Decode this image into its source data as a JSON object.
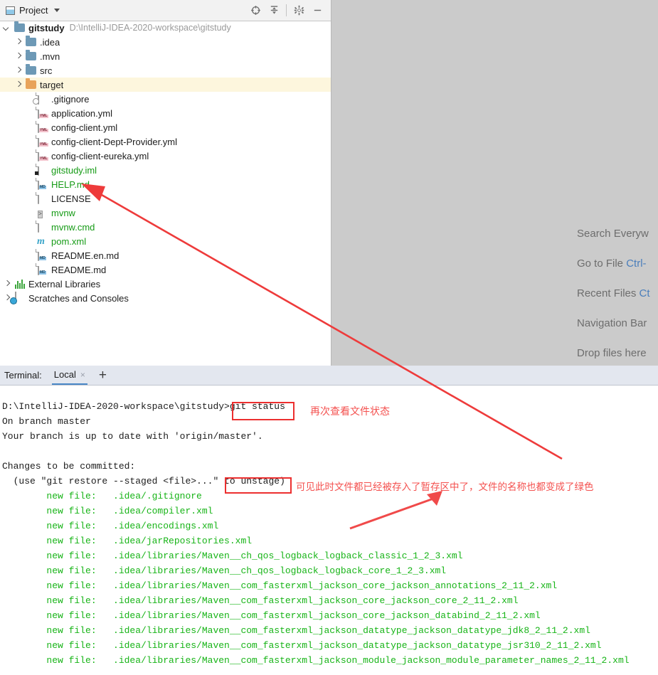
{
  "project_panel": {
    "title": "Project",
    "icons": [
      "locate-icon",
      "collapse-all-icon",
      "settings-gear-icon",
      "hide-icon"
    ],
    "root": {
      "name": "gitstudy",
      "path": "D:\\IntelliJ-IDEA-2020-workspace\\gitstudy"
    },
    "items": [
      {
        "label": ".idea",
        "icon": "folder-icon",
        "expandable": true,
        "indent": 1,
        "color": "default",
        "selected": false
      },
      {
        "label": ".mvn",
        "icon": "folder-icon",
        "expandable": true,
        "indent": 1,
        "color": "default",
        "selected": false
      },
      {
        "label": "src",
        "icon": "folder-icon",
        "expandable": true,
        "indent": 1,
        "color": "default",
        "selected": false
      },
      {
        "label": "target",
        "icon": "folder-orange-icon",
        "expandable": true,
        "indent": 1,
        "color": "default",
        "selected": true
      },
      {
        "label": ".gitignore",
        "icon": "gitignore-file-icon",
        "expandable": false,
        "indent": 2,
        "color": "default",
        "selected": false
      },
      {
        "label": "application.yml",
        "icon": "yml-file-icon",
        "expandable": false,
        "indent": 2,
        "color": "default",
        "selected": false
      },
      {
        "label": "config-client.yml",
        "icon": "yml-file-icon",
        "expandable": false,
        "indent": 2,
        "color": "default",
        "selected": false
      },
      {
        "label": "config-client-Dept-Provider.yml",
        "icon": "yml-file-icon",
        "expandable": false,
        "indent": 2,
        "color": "default",
        "selected": false
      },
      {
        "label": "config-client-eureka.yml",
        "icon": "yml-file-icon",
        "expandable": false,
        "indent": 2,
        "color": "default",
        "selected": false
      },
      {
        "label": "gitstudy.iml",
        "icon": "iml-file-icon",
        "expandable": false,
        "indent": 2,
        "color": "green",
        "selected": false
      },
      {
        "label": "HELP.md",
        "icon": "md-file-icon",
        "expandable": false,
        "indent": 2,
        "color": "green",
        "selected": false
      },
      {
        "label": "LICENSE",
        "icon": "text-file-icon",
        "expandable": false,
        "indent": 2,
        "color": "default",
        "selected": false
      },
      {
        "label": "mvnw",
        "icon": "script-file-icon",
        "expandable": false,
        "indent": 2,
        "color": "green",
        "selected": false
      },
      {
        "label": "mvnw.cmd",
        "icon": "text-file-icon",
        "expandable": false,
        "indent": 2,
        "color": "green",
        "selected": false
      },
      {
        "label": "pom.xml",
        "icon": "maven-file-icon",
        "expandable": false,
        "indent": 2,
        "color": "green",
        "selected": false
      },
      {
        "label": "README.en.md",
        "icon": "md-file-icon",
        "expandable": false,
        "indent": 2,
        "color": "default",
        "selected": false
      },
      {
        "label": "README.md",
        "icon": "md-file-icon",
        "expandable": false,
        "indent": 2,
        "color": "default",
        "selected": false
      },
      {
        "label": "External Libraries",
        "icon": "libraries-icon",
        "expandable": true,
        "indent": 0,
        "color": "default",
        "selected": false
      },
      {
        "label": "Scratches and Consoles",
        "icon": "scratches-icon",
        "expandable": true,
        "indent": 0,
        "color": "default",
        "selected": false
      }
    ]
  },
  "editor": {
    "hints": [
      {
        "action": "Search Everyw",
        "key": ""
      },
      {
        "action": "Go to File ",
        "key": "Ctrl-"
      },
      {
        "action": "Recent Files ",
        "key": "Ct"
      },
      {
        "action": "Navigation Bar",
        "key": ""
      },
      {
        "action": "Drop files here",
        "key": ""
      }
    ]
  },
  "terminal": {
    "label": "Terminal:",
    "tabs": [
      {
        "name": "Local",
        "active": true,
        "close": "×"
      }
    ],
    "add_tab": "+",
    "lines": [
      {
        "text": "D:\\IntelliJ-IDEA-2020-workspace\\gitstudy>git status",
        "color": "default"
      },
      {
        "text": "On branch master",
        "color": "default"
      },
      {
        "text": "Your branch is up to date with 'origin/master'.",
        "color": "default"
      },
      {
        "text": "",
        "color": "default"
      },
      {
        "text": "Changes to be committed:",
        "color": "default"
      },
      {
        "text": "  (use \"git restore --staged <file>...\" to unstage)",
        "color": "default"
      },
      {
        "text": "        new file:   .idea/.gitignore",
        "color": "green"
      },
      {
        "text": "        new file:   .idea/compiler.xml",
        "color": "green"
      },
      {
        "text": "        new file:   .idea/encodings.xml",
        "color": "green"
      },
      {
        "text": "        new file:   .idea/jarRepositories.xml",
        "color": "green"
      },
      {
        "text": "        new file:   .idea/libraries/Maven__ch_qos_logback_logback_classic_1_2_3.xml",
        "color": "green"
      },
      {
        "text": "        new file:   .idea/libraries/Maven__ch_qos_logback_logback_core_1_2_3.xml",
        "color": "green"
      },
      {
        "text": "        new file:   .idea/libraries/Maven__com_fasterxml_jackson_core_jackson_annotations_2_11_2.xml",
        "color": "green"
      },
      {
        "text": "        new file:   .idea/libraries/Maven__com_fasterxml_jackson_core_jackson_core_2_11_2.xml",
        "color": "green"
      },
      {
        "text": "        new file:   .idea/libraries/Maven__com_fasterxml_jackson_core_jackson_databind_2_11_2.xml",
        "color": "green"
      },
      {
        "text": "        new file:   .idea/libraries/Maven__com_fasterxml_jackson_datatype_jackson_datatype_jdk8_2_11_2.xml",
        "color": "green"
      },
      {
        "text": "        new file:   .idea/libraries/Maven__com_fasterxml_jackson_datatype_jackson_datatype_jsr310_2_11_2.xml",
        "color": "green"
      },
      {
        "text": "        new file:   .idea/libraries/Maven__com_fasterxml_jackson_module_jackson_module_parameter_names_2_11_2.xml",
        "color": "green"
      }
    ]
  },
  "annotations": {
    "accent_color": "#ec2f2f",
    "note_status": "再次查看文件状态",
    "note_staged": "可见此时文件都已经被存入了暂存区中了，文件的名称也都变成了绿色"
  }
}
